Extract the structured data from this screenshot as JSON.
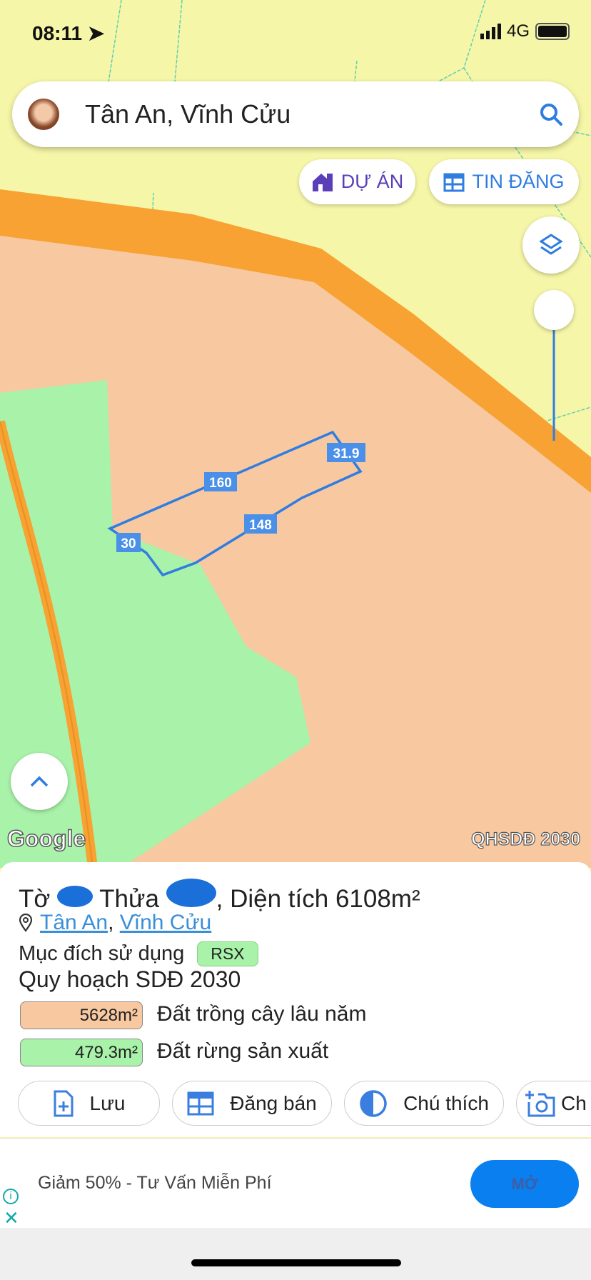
{
  "status_bar": {
    "time": "08:11",
    "network": "4G"
  },
  "search": {
    "value": "Tân An, Vĩnh Cửu"
  },
  "map_buttons": {
    "du_an": "DỰ ÁN",
    "tin_dang": "TIN ĐĂNG"
  },
  "map": {
    "edge_labels": [
      "160",
      "31.9",
      "148",
      "30"
    ],
    "logo": "Google",
    "layer_label": "QHSDĐ 2030",
    "colors": {
      "background": "#f6f6a8",
      "road": "#f7a232",
      "perennial_land": "#f8c8a0",
      "forest_land": "#a9f2a9",
      "parcel": "#2f7de1"
    }
  },
  "panel": {
    "title_prefix": "Tờ",
    "title_middle": "Thửa",
    "title_suffix": ", Diện tích 6108m²",
    "location_ward": "Tân An",
    "location_district": "Vĩnh Cửu",
    "usage_label": "Mục đích sử dụng",
    "usage_badge": "RSX",
    "plan_title": "Quy hoạch SDĐ 2030",
    "plan_items": [
      {
        "area": "5628m²",
        "label": "Đất trồng cây lâu năm",
        "color": "#f8c8a0"
      },
      {
        "area": "479.3m²",
        "label": "Đất rừng sản xuất",
        "color": "#a9f2a9"
      }
    ],
    "actions": [
      "Lưu",
      "Đăng bán",
      "Chú thích",
      "Ch"
    ]
  },
  "ad": {
    "text": "Giảm 50% - Tư Vấn Miễn Phí",
    "button": "MỞ"
  }
}
